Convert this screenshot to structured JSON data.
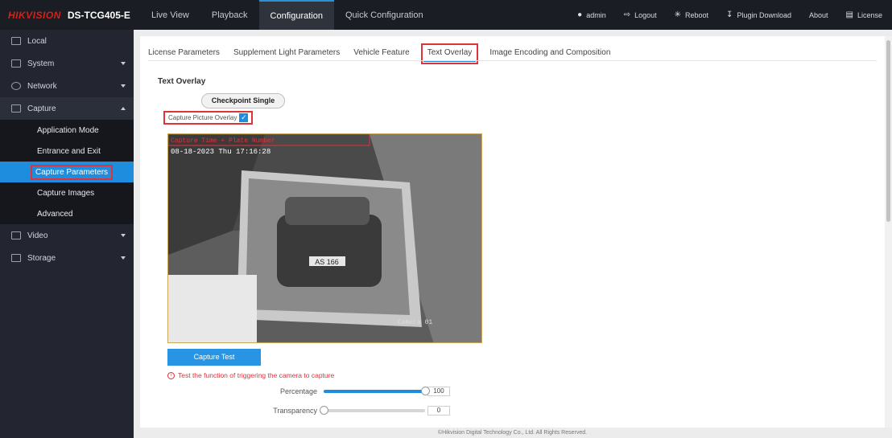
{
  "header": {
    "brand": "HIKVISION",
    "model": "DS-TCG405-E",
    "nav": [
      {
        "label": "Live View"
      },
      {
        "label": "Playback"
      },
      {
        "label": "Configuration",
        "active": true
      },
      {
        "label": "Quick Configuration"
      }
    ],
    "right": [
      {
        "icon": "user-icon",
        "label": "admin"
      },
      {
        "icon": "logout-icon",
        "label": "Logout"
      },
      {
        "icon": "reboot-icon",
        "label": "Reboot"
      },
      {
        "icon": "download-icon",
        "label": "Plugin Download"
      },
      {
        "icon": "",
        "label": "About"
      },
      {
        "icon": "license-icon",
        "label": "License"
      }
    ]
  },
  "sidebar": {
    "items": [
      {
        "label": "Local"
      },
      {
        "label": "System"
      },
      {
        "label": "Network"
      },
      {
        "label": "Capture"
      },
      {
        "label": "Video"
      },
      {
        "label": "Storage"
      }
    ],
    "capture_sub": [
      {
        "label": "Application Mode"
      },
      {
        "label": "Entrance and Exit"
      },
      {
        "label": "Capture Parameters",
        "active": true
      },
      {
        "label": "Capture Images"
      },
      {
        "label": "Advanced"
      }
    ]
  },
  "tabs": [
    {
      "label": "License Parameters"
    },
    {
      "label": "Supplement Light Parameters"
    },
    {
      "label": "Vehicle Feature"
    },
    {
      "label": "Text Overlay",
      "active": true
    },
    {
      "label": "Image Encoding and Composition"
    }
  ],
  "content": {
    "section_title": "Text Overlay",
    "mode_button": "Checkpoint Single",
    "overlay_checkbox_label": "Capture Picture Overlay",
    "overlay_checked": true,
    "preview": {
      "overlay_text_1": "Capture Time + Plate Number",
      "timestamp": "08-18-2023 Thu 17:16:28",
      "plate": "AS 166",
      "camera_label": "Camera 01"
    },
    "capture_button": "Capture Test",
    "hint": "Test the function of triggering the camera to capture",
    "sliders": [
      {
        "label": "Percentage",
        "value": 100,
        "max": 100
      },
      {
        "label": "Transparency",
        "value": 0,
        "max": 100
      }
    ]
  },
  "footer": "©Hikvision Digital Technology Co., Ltd. All Rights Reserved."
}
